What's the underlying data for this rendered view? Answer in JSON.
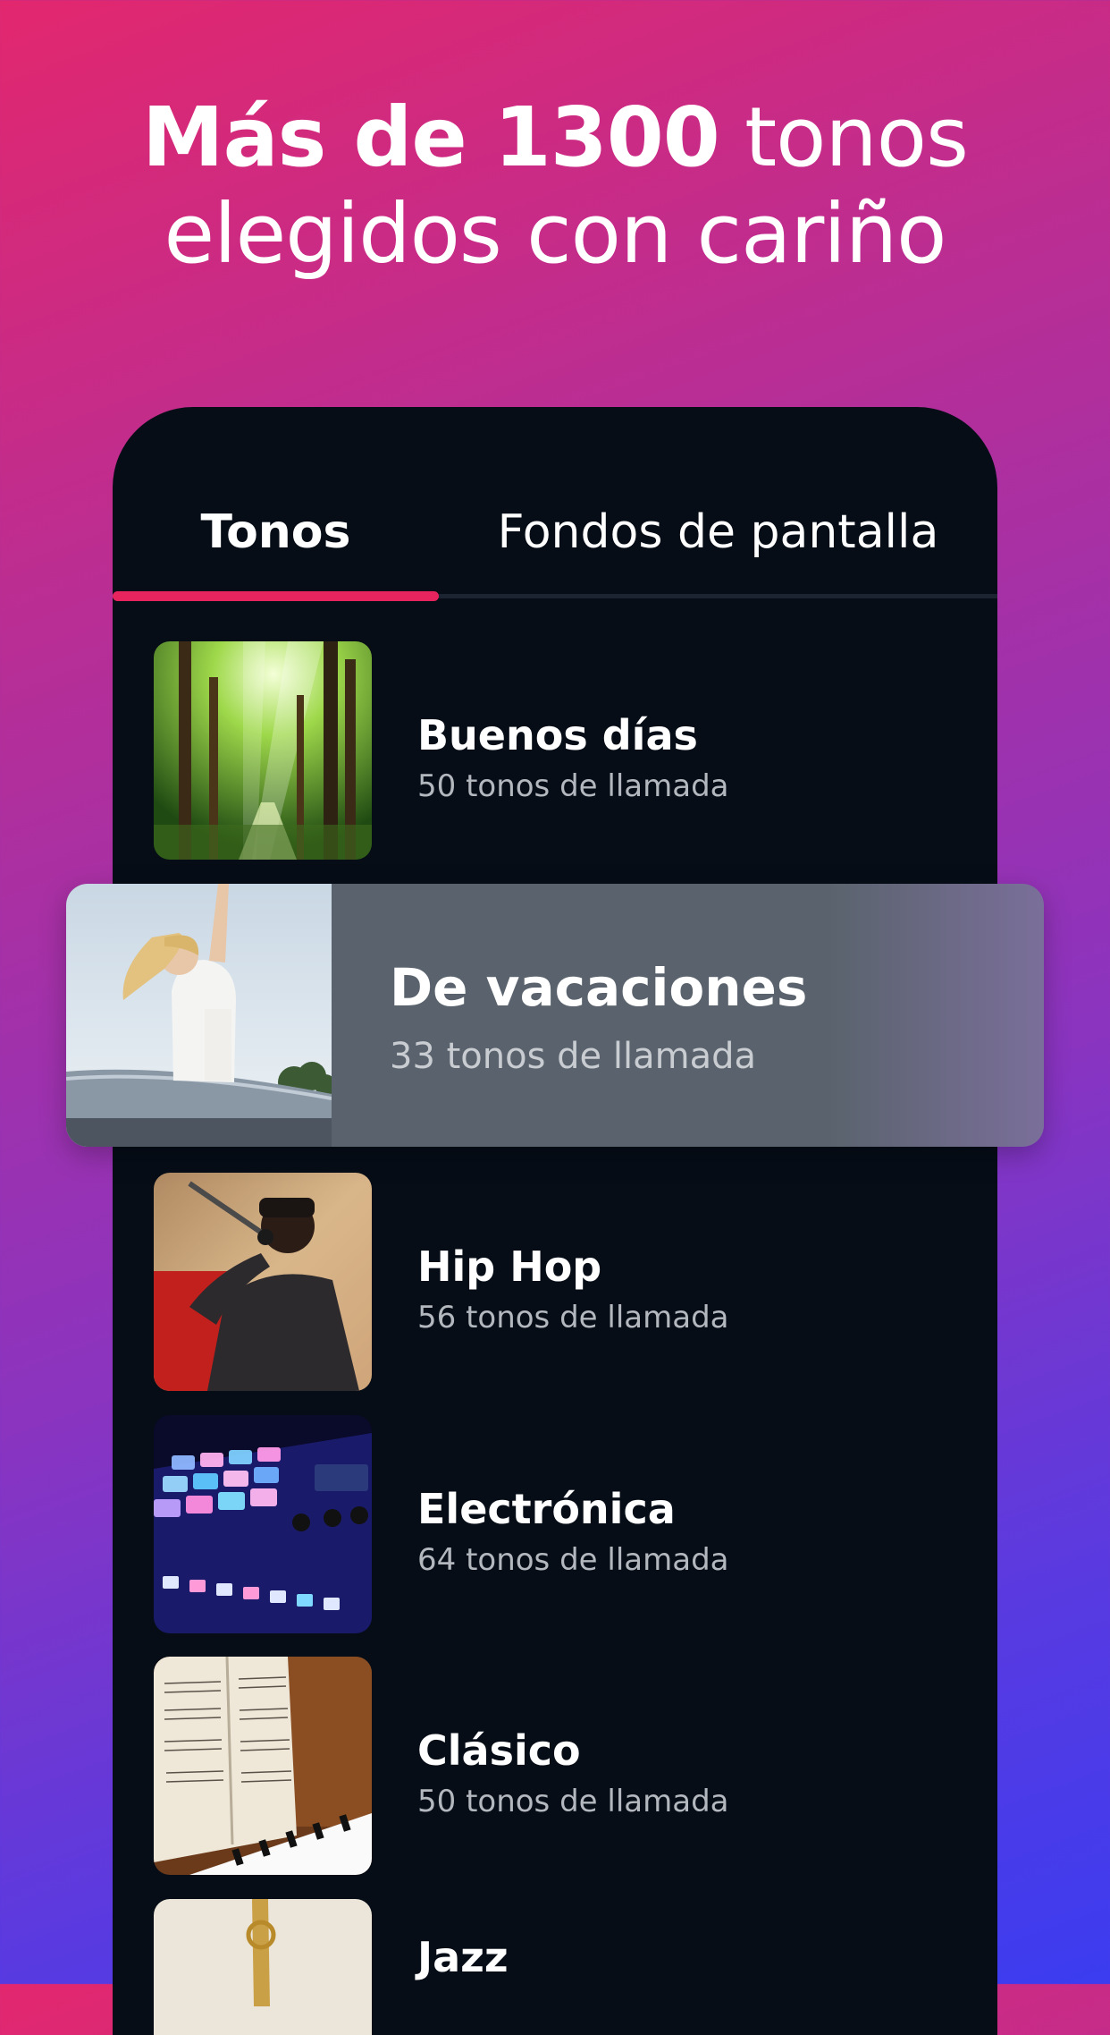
{
  "headline": {
    "bold": "Más de 1300",
    "rest_line1": "tonos",
    "line2": "elegidos con cariño"
  },
  "tabs": [
    {
      "label": "Tonos",
      "active": true
    },
    {
      "label": "Fondos de pantalla",
      "active": false
    }
  ],
  "colors": {
    "accent": "#e8245e",
    "phone_background": "#060d17",
    "featured_card": "#5a636d"
  },
  "featured": {
    "title": "De vacaciones",
    "subtitle": "33 tonos de llamada",
    "image": "woman-on-car-roof-photo"
  },
  "categories": [
    {
      "title": "Buenos días",
      "subtitle": "50 tonos de llamada",
      "image": "forest-sunlight-photo"
    },
    {
      "title": "Hip Hop",
      "subtitle": "56 tonos de llamada",
      "image": "rapper-microphone-photo"
    },
    {
      "title": "Electrónica",
      "subtitle": "64 tonos de llamada",
      "image": "drum-pad-controller-photo"
    },
    {
      "title": "Clásico",
      "subtitle": "50 tonos de llamada",
      "image": "sheet-music-piano-photo"
    },
    {
      "title": "Jazz",
      "subtitle": "",
      "image": "trumpet-photo"
    }
  ]
}
